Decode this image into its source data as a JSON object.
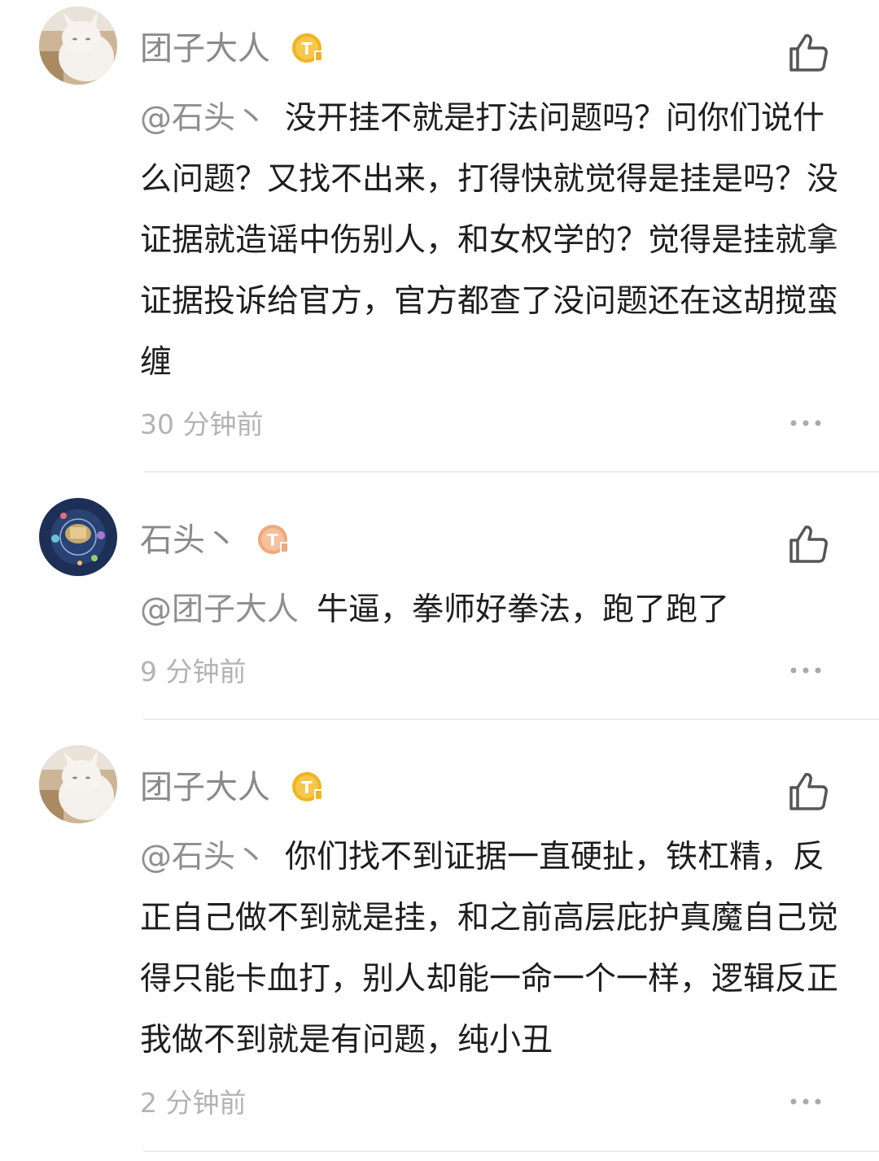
{
  "comments": [
    {
      "username": "团子大人",
      "avatar_icon": "white-cat-avatar",
      "badge_icon": "gold-level-badge",
      "mention": "@石头丶",
      "text": "没开挂不就是打法问题吗？问你们说什么问题？又找不出来，打得快就觉得是挂是吗？没证据就造谣中伤别人，和女权学的？觉得是挂就拿证据投诉给官方，官方都查了没问题还在这胡搅蛮缠",
      "time": "30 分钟前"
    },
    {
      "username": "石头丶",
      "avatar_icon": "game-map-avatar",
      "badge_icon": "orange-level-badge",
      "mention": "@团子大人",
      "text": "牛逼，拳师好拳法，跑了跑了",
      "time": "9 分钟前"
    },
    {
      "username": "团子大人",
      "avatar_icon": "white-cat-avatar",
      "badge_icon": "gold-level-badge",
      "mention": "@石头丶",
      "text": "你们找不到证据一直硬扯，铁杠精，反正自己做不到就是挂，和之前高层庇护真魔自己觉得只能卡血打，别人却能一命一个一样，逻辑反正我做不到就是有问题，纯小丑",
      "time": "2 分钟前"
    }
  ],
  "colors": {
    "username": "#8a8a8a",
    "body_text": "#1e1e1e",
    "mention": "#8f8f8f",
    "time": "#b3b3b3",
    "divider": "#ececec",
    "badge_gold": "#f2b320",
    "badge_orange": "#f0a878"
  }
}
